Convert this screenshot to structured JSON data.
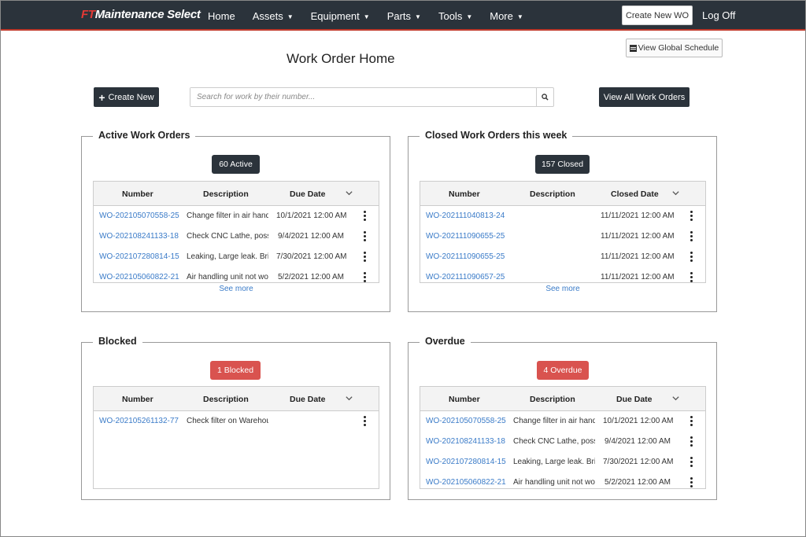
{
  "brand": {
    "prefix": "FT",
    "name": "Maintenance Select"
  },
  "nav": {
    "home": "Home",
    "assets": "Assets",
    "equipment": "Equipment",
    "parts": "Parts",
    "tools": "Tools",
    "more": "More",
    "create_wo": "Create New WO",
    "logoff": "Log Off"
  },
  "toolbar": {
    "global_schedule": "View Global Schedule",
    "page_title": "Work Order Home",
    "create_new": "Create New",
    "search_placeholder": "Search for work by their number...",
    "view_all": "View All Work Orders"
  },
  "active": {
    "title": "Active Work Orders",
    "badge": "60 Active",
    "headers": {
      "number": "Number",
      "description": "Description",
      "date": "Due Date"
    },
    "rows": [
      {
        "number": "WO-202105070558-25",
        "description": "Change filter in air handling",
        "date": "10/1/2021 12:00 AM"
      },
      {
        "number": "WO-202108241133-18",
        "description": "Check CNC Lathe, possible",
        "date": "9/4/2021 12:00 AM"
      },
      {
        "number": "WO-202107280814-15",
        "description": "Leaking, Large leak. Bring",
        "date": "7/30/2021 12:00 AM"
      },
      {
        "number": "WO-202105060822-21",
        "description": "Air handling unit not working",
        "date": "5/2/2021 12:00 AM"
      }
    ],
    "see_more": "See more"
  },
  "closed": {
    "title": "Closed Work Orders this week",
    "badge": "157 Closed",
    "headers": {
      "number": "Number",
      "description": "Description",
      "date": "Closed Date"
    },
    "rows": [
      {
        "number": "WO-202111040813-24",
        "description": "",
        "date": "11/11/2021 12:00 AM"
      },
      {
        "number": "WO-202111090655-25",
        "description": "",
        "date": "11/11/2021 12:00 AM"
      },
      {
        "number": "WO-202111090655-25",
        "description": "",
        "date": "11/11/2021 12:00 AM"
      },
      {
        "number": "WO-202111090657-25",
        "description": "",
        "date": "11/11/2021 12:00 AM"
      }
    ],
    "see_more": "See more"
  },
  "blocked": {
    "title": "Blocked",
    "badge": "1 Blocked",
    "headers": {
      "number": "Number",
      "description": "Description",
      "date": "Due Date"
    },
    "rows": [
      {
        "number": "WO-202105261132-77",
        "description": "Check filter on Warehouse",
        "date": ""
      }
    ]
  },
  "overdue": {
    "title": "Overdue",
    "badge": "4 Overdue",
    "headers": {
      "number": "Number",
      "description": "Description",
      "date": "Due Date"
    },
    "rows": [
      {
        "number": "WO-202105070558-25",
        "description": "Change filter in air handling",
        "date": "10/1/2021 12:00 AM"
      },
      {
        "number": "WO-202108241133-18",
        "description": "Check CNC Lathe, possible",
        "date": "9/4/2021 12:00 AM"
      },
      {
        "number": "WO-202107280814-15",
        "description": "Leaking, Large leak. Bring",
        "date": "7/30/2021 12:00 AM"
      },
      {
        "number": "WO-202105060822-21",
        "description": "Air handling unit not working",
        "date": "5/2/2021 12:00 AM"
      }
    ]
  },
  "colors": {
    "navbar": "#2b333b",
    "accent_red": "#d9534f",
    "link": "#3a7bc8"
  },
  "icons": {
    "search": "search-icon",
    "calendar": "calendar-icon",
    "kebab": "kebab-menu-icon",
    "chevron": "chevron-down-icon",
    "plus": "plus-icon"
  }
}
